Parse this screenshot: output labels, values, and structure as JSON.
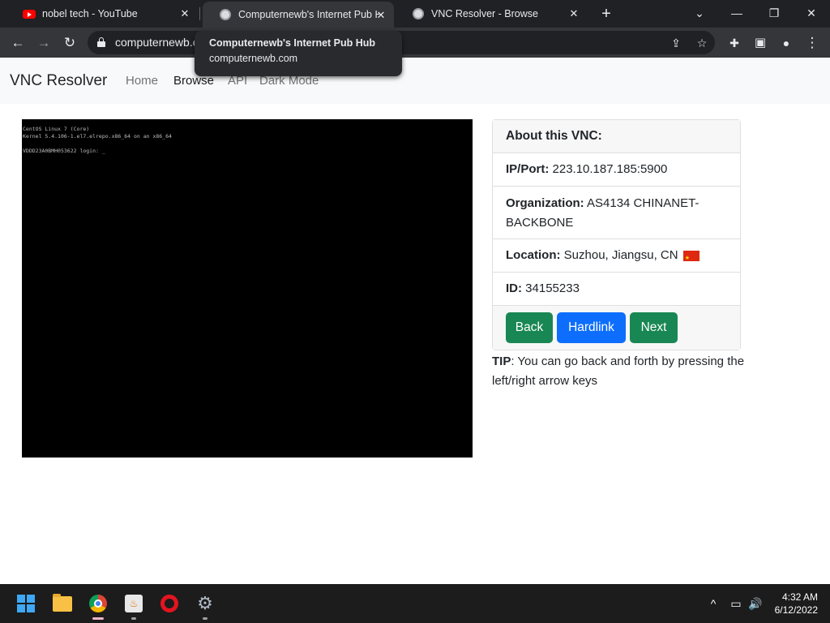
{
  "browser": {
    "tabs": [
      {
        "title": "nobel tech - YouTube",
        "icon": "youtube-icon"
      },
      {
        "title": "Computernewb's Internet Pub Hub",
        "icon": "pub-hub-icon"
      },
      {
        "title": "VNC Resolver - Browse",
        "icon": "pub-hub-icon"
      }
    ],
    "url": "computernewb.com/vncresolver/browse",
    "url_visible": "computernewb.c",
    "tooltip": {
      "title": "Computernewb's Internet Pub Hub",
      "url": "computernewb.com"
    },
    "icons": {
      "close": "✕",
      "new_tab": "+",
      "tab_search": "⌄",
      "minimize": "—",
      "restore": "❐",
      "back": "←",
      "forward": "→",
      "reload": "↻",
      "share": "⇪",
      "star": "☆",
      "extensions": "✚",
      "side_panel": "▣",
      "profile": "●",
      "menu": "⋮"
    }
  },
  "site": {
    "brand": "VNC Resolver",
    "nav": [
      "Home",
      "Browse",
      "API",
      "Dark Mode"
    ],
    "active_nav": "Browse",
    "vnc_console": [
      "CentOS Linux 7 (Core)",
      "Kernel 5.4.106-1.el7.elrepo.x86_64 on an x86_64",
      "VDDD23A0BMH053622 login: _"
    ],
    "card": {
      "header": "About this VNC:",
      "ip_label": "IP/Port:",
      "ip_value": "223.10.187.185:5900",
      "org_label": "Organization:",
      "org_value": "AS4134 CHINANET-BACKBONE",
      "loc_label": "Location:",
      "loc_value": "Suzhou, Jiangsu, CN",
      "id_label": "ID:",
      "id_value": "34155233",
      "buttons": {
        "back": "Back",
        "hardlink": "Hardlink",
        "next": "Next"
      }
    },
    "tip_label": "TIP",
    "tip_text": ": You can go back and forth by pressing the left/right arrow keys"
  },
  "taskbar": {
    "apps": [
      "start-icon",
      "file-explorer-icon",
      "chrome-icon",
      "java-icon",
      "opera-icon",
      "settings-icon"
    ],
    "tray": {
      "chevron": "^",
      "network": "▭",
      "volume": "🔊"
    },
    "time": "4:32 AM",
    "date": "6/12/2022"
  },
  "colors": {
    "success": "#198754",
    "primary": "#0d6efd",
    "browser_dark": "#202124",
    "taskbar": "#1c1c1c"
  }
}
